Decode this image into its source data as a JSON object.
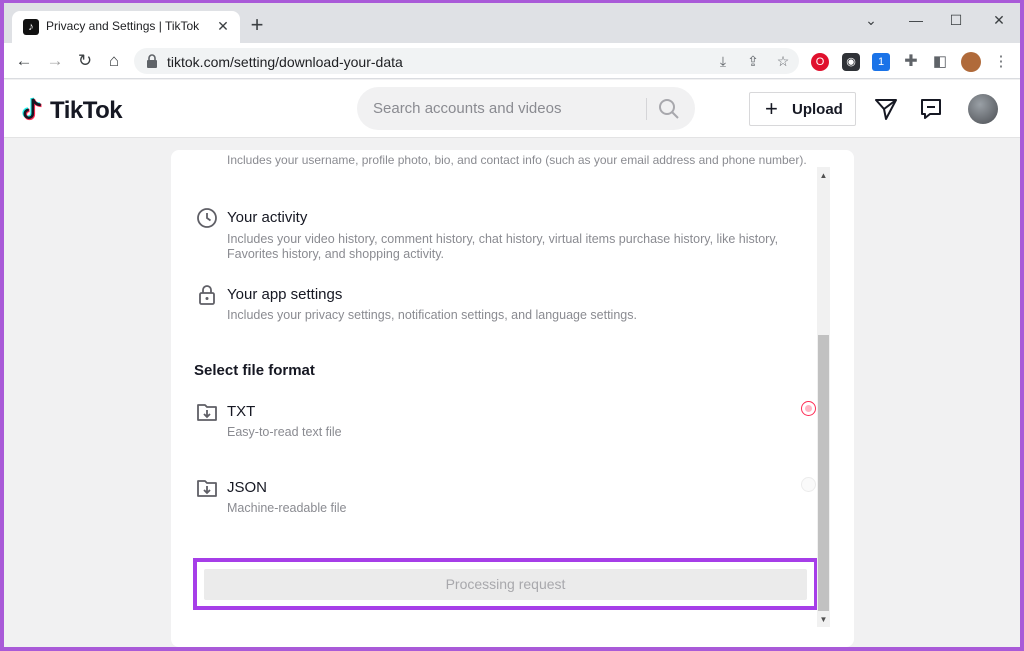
{
  "browser": {
    "tab_title": "Privacy and Settings | TikTok",
    "url": "tiktok.com/setting/download-your-data",
    "extension_badge": "1"
  },
  "header": {
    "logo_text": "TikTok",
    "search_placeholder": "Search accounts and videos",
    "upload_label": "Upload"
  },
  "content": {
    "clipped_text": "Includes your username, profile photo, bio, and contact info (such as your email address and phone number).",
    "data_items": [
      {
        "title": "Your activity",
        "description": "Includes your video history, comment history, chat history, virtual items purchase history, like history, Favorites history, and shopping activity."
      },
      {
        "title": "Your app settings",
        "description": "Includes your privacy settings, notification settings, and language settings."
      }
    ],
    "file_format_heading": "Select file format",
    "formats": [
      {
        "title": "TXT",
        "description": "Easy-to-read text file",
        "selected": true
      },
      {
        "title": "JSON",
        "description": "Machine-readable file",
        "selected": false
      }
    ],
    "button_label": "Processing request"
  },
  "colors": {
    "accent": "#fe2c55",
    "highlight": "#a63ee8",
    "frame": "#a95ad8"
  },
  "icons": [
    "clock-icon",
    "lock-icon",
    "download-folder-icon",
    "search-icon",
    "send-icon",
    "inbox-icon"
  ]
}
